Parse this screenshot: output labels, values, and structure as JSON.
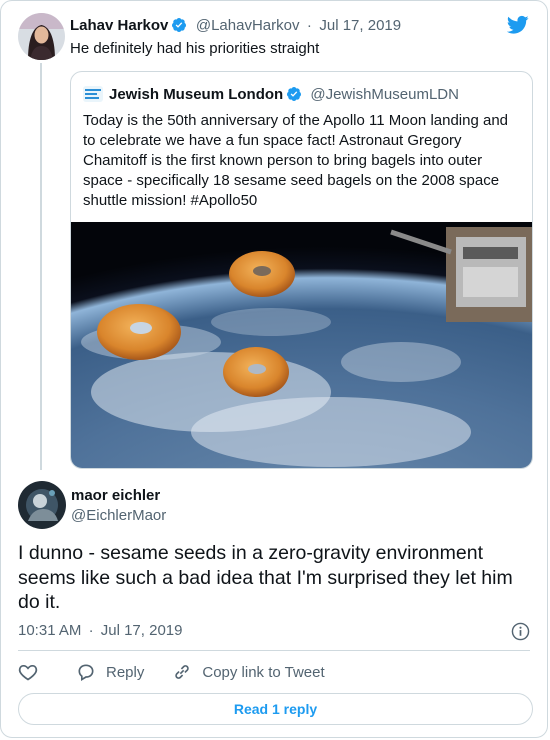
{
  "parent": {
    "name": "Lahav Harkov",
    "handle": "@LahavHarkov",
    "separator": "·",
    "date": "Jul 17, 2019",
    "text": "He definitely had his priorities straight"
  },
  "quote": {
    "name": "Jewish Museum London",
    "handle": "@JewishMuseumLDN",
    "text": "Today is the 50th anniversary of the Apollo 11 Moon landing and to celebrate we have a fun space fact! Astronaut Gregory Chamitoff is the first known person to bring bagels into outer space - specifically 18 sesame seed bagels on the 2008 space shuttle mission! #Apollo50"
  },
  "reply": {
    "name": "maor eichler",
    "handle": "@EichlerMaor",
    "text": "I dunno - sesame seeds in a zero-gravity environment seems like such a bad idea that I'm surprised they let him do it.",
    "time": "10:31 AM",
    "separator": "·",
    "date": "Jul 17, 2019"
  },
  "actions": {
    "reply_label": "Reply",
    "copy_label": "Copy link to Tweet"
  },
  "read_button": "Read 1 reply",
  "colors": {
    "accent": "#1d9bf0",
    "text": "#0f1419",
    "muted": "#536471",
    "border": "#cfd9de"
  },
  "icons": [
    "verified-icon",
    "twitter-bird-icon",
    "info-icon",
    "heart-icon",
    "reply-icon",
    "link-icon"
  ]
}
